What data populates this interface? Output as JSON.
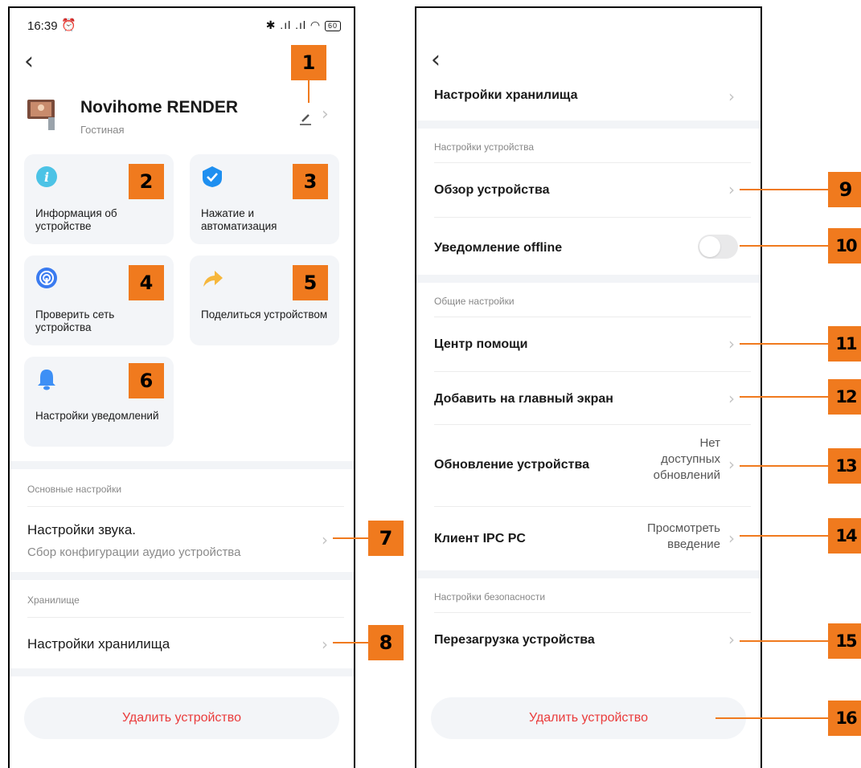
{
  "status_bar": {
    "time": "16:39",
    "alarm_icon": "alarm-clock-icon",
    "signal_icons": "✱ .ıl .ıl",
    "battery": "60"
  },
  "device": {
    "name": "Novihome RENDER",
    "room": "Гостиная"
  },
  "tiles": [
    {
      "label": "Информация об устройстве",
      "icon": "info-icon",
      "color": "#4cc3e6"
    },
    {
      "label": "Нажатие и автоматизация",
      "icon": "check-shield-icon",
      "color": "#1e8ff0"
    },
    {
      "label": "Проверить сеть устройства",
      "icon": "network-check-icon",
      "color": "#3a7bf0"
    },
    {
      "label": "Поделиться устройством",
      "icon": "share-arrow-icon",
      "color": "#f6b73c"
    },
    {
      "label": "Настройки уведомлений",
      "icon": "bell-icon",
      "color": "#3d8ff5"
    }
  ],
  "left": {
    "section_basic": "Основные настройки",
    "sound_title": "Настройки звука.",
    "sound_sub": "Сбор конфигурации аудио устройства",
    "section_storage": "Хранилище",
    "storage_title": "Настройки хранилища",
    "delete_label": "Удалить устройство"
  },
  "right": {
    "storage_title": "Настройки хранилища",
    "section_device": "Настройки устройства",
    "overview": "Обзор устройства",
    "offline_notify": "Уведомление offline",
    "offline_enabled": false,
    "section_general": "Общие настройки",
    "help_center": "Центр помощи",
    "add_home": "Добавить на главный экран",
    "update_title": "Обновление устройства",
    "update_value_l1": "Нет",
    "update_value_l2": "доступных",
    "update_value_l3": "обновлений",
    "ipc_title": "Клиент IPC PC",
    "ipc_value_l1": "Просмотреть",
    "ipc_value_l2": "введение",
    "section_security": "Настройки безопасности",
    "reboot": "Перезагрузка устройства",
    "delete_label": "Удалить устройство"
  },
  "badges": [
    "1",
    "2",
    "3",
    "4",
    "5",
    "6",
    "7",
    "8",
    "9",
    "10",
    "11",
    "12",
    "13",
    "14",
    "15",
    "16"
  ],
  "colors": {
    "badge": "#f07a1e",
    "delete": "#ea3b3b",
    "tile_bg": "#f3f5f8"
  }
}
